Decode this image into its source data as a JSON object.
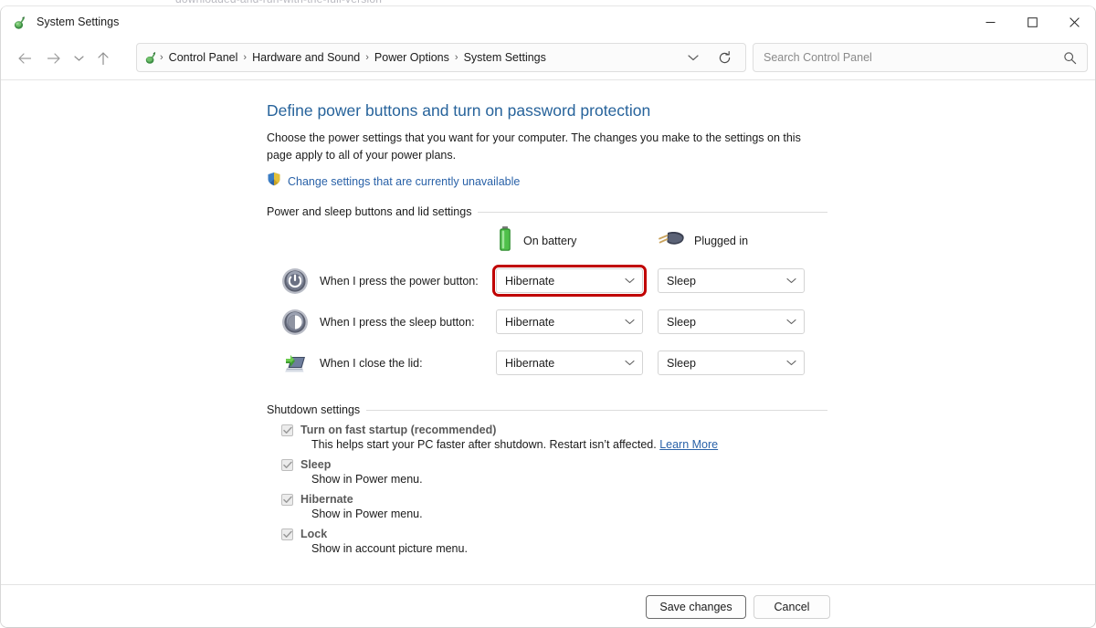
{
  "window": {
    "title": "System Settings",
    "app_icon": "control-panel-icon",
    "controls": {
      "minimize": "minimize-icon",
      "maximize": "maximize-icon",
      "close": "close-icon"
    },
    "ghost_top_text": "downloaded-and-run-with-the-full-version"
  },
  "toolbar": {
    "back": "back-arrow-icon",
    "forward": "forward-arrow-icon",
    "recent": "recent-locations-chevron-icon",
    "up": "up-arrow-icon",
    "address_dropdown": "previous-locations-chevron-icon",
    "refresh": "refresh-icon"
  },
  "breadcrumb": {
    "icon": "control-panel-icon",
    "separator": "›",
    "items": [
      "Control Panel",
      "Hardware and Sound",
      "Power Options",
      "System Settings"
    ]
  },
  "search": {
    "placeholder": "Search Control Panel",
    "icon": "search-icon"
  },
  "page": {
    "heading": "Define power buttons and turn on password protection",
    "description": "Choose the power settings that you want for your computer. The changes you make to the settings on this page apply to all of your power plans.",
    "uac_link": "Change settings that are currently unavailable",
    "uac_icon": "uac-shield-icon"
  },
  "power_section": {
    "group_label": "Power and sleep buttons and lid settings",
    "columns": [
      {
        "label": "On battery",
        "icon": "battery-icon"
      },
      {
        "label": "Plugged in",
        "icon": "power-plug-icon"
      }
    ],
    "rows": [
      {
        "icon": "power-button-icon",
        "label": "When I press the power button:",
        "on_battery": "Hibernate",
        "plugged_in": "Sleep",
        "highlighted": "on_battery"
      },
      {
        "icon": "sleep-button-icon",
        "label": "When I press the sleep button:",
        "on_battery": "Hibernate",
        "plugged_in": "Sleep",
        "highlighted": ""
      },
      {
        "icon": "laptop-lid-icon",
        "label": "When I close the lid:",
        "on_battery": "Hibernate",
        "plugged_in": "Sleep",
        "highlighted": ""
      }
    ],
    "dropdown_arrow_icon": "chevron-down-icon"
  },
  "shutdown_section": {
    "group_label": "Shutdown settings",
    "items": [
      {
        "label": "Turn on fast startup (recommended)",
        "checked": true,
        "description": "This helps start your PC faster after shutdown. Restart isn’t affected.",
        "link": "Learn More"
      },
      {
        "label": "Sleep",
        "checked": true,
        "description": "Show in Power menu.",
        "link": ""
      },
      {
        "label": "Hibernate",
        "checked": true,
        "description": "Show in Power menu.",
        "link": ""
      },
      {
        "label": "Lock",
        "checked": true,
        "description": "Show in account picture menu.",
        "link": ""
      }
    ]
  },
  "footer": {
    "save_label": "Save changes",
    "cancel_label": "Cancel"
  },
  "colors": {
    "heading_blue": "#27639b",
    "link_blue": "#2a62a8",
    "highlight_red": "#c00000",
    "battery_green": "#39a93b"
  }
}
